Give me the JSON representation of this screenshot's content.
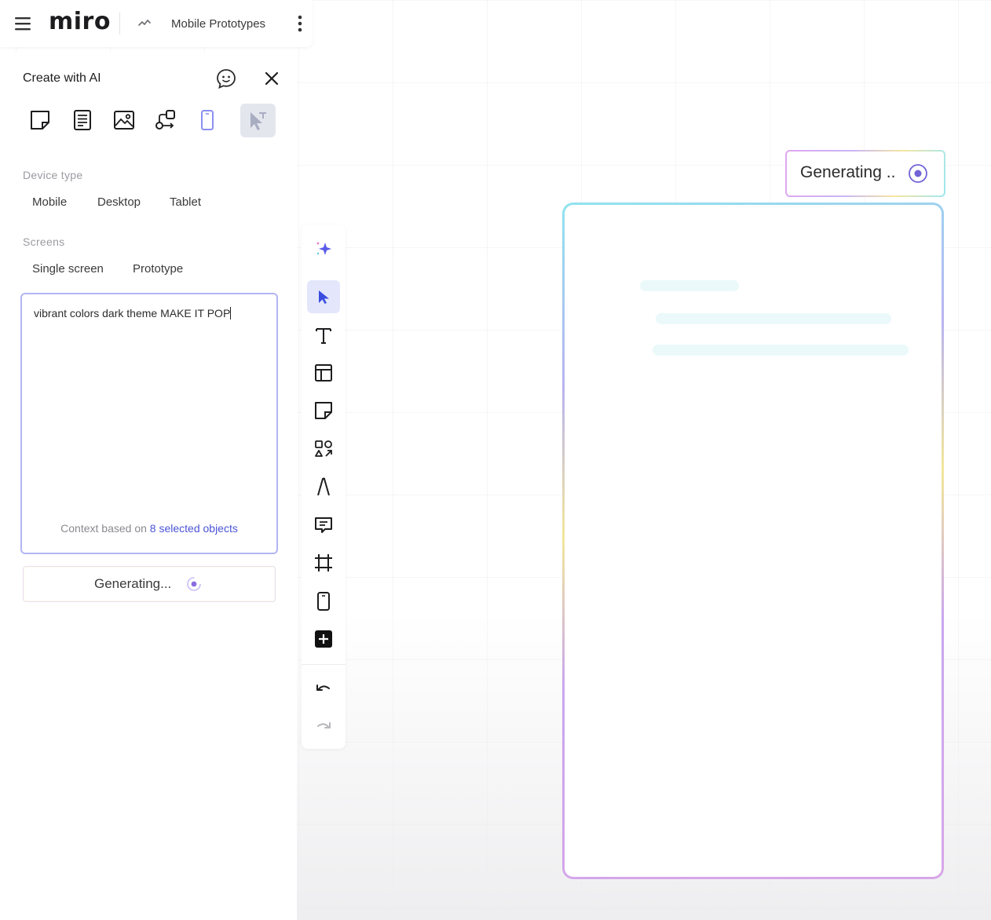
{
  "app": {
    "logo": "miro",
    "board_name": "Mobile Prototypes"
  },
  "ai_panel": {
    "title": "Create with AI",
    "tools": [
      "sticky-note-icon",
      "document-icon",
      "image-icon",
      "diagram-icon",
      "mobile-screen-icon",
      "prototype-icon"
    ],
    "device_type": {
      "label": "Device type",
      "options": [
        "Mobile",
        "Desktop",
        "Tablet"
      ]
    },
    "screens": {
      "label": "Screens",
      "options": [
        "Single screen",
        "Prototype"
      ]
    },
    "prompt": {
      "value": "vibrant colors dark theme MAKE IT POP",
      "context_prefix": "Context based on",
      "context_link": "8 selected objects"
    },
    "generate_button": "Generating..."
  },
  "toolbar": {
    "items": [
      "ai-sparkle-icon",
      "select-cursor-icon",
      "text-icon",
      "template-icon",
      "sticky-note-icon",
      "shapes-icon",
      "pen-icon",
      "comment-icon",
      "frame-icon",
      "mobile-frame-icon",
      "plus-icon",
      "undo-icon",
      "redo-icon"
    ]
  },
  "canvas": {
    "generating_label": "Generating .."
  },
  "colors": {
    "accent": "#4a54d6",
    "accent_light": "#b3b6f2",
    "spinner": "#8a6ce0"
  }
}
